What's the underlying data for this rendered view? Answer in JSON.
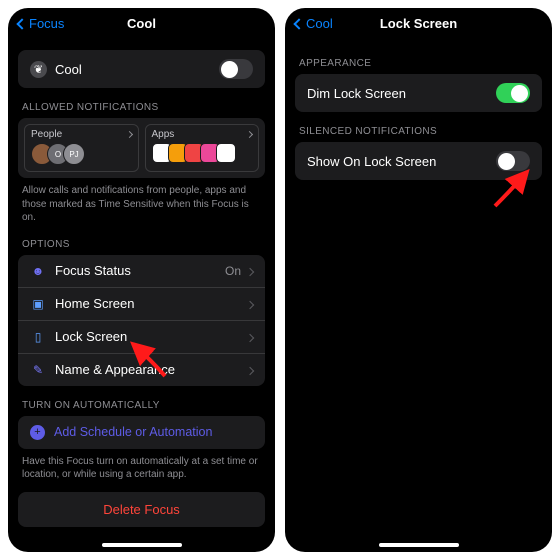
{
  "left": {
    "back_label": "Focus",
    "title": "Cool",
    "focus_name": "Cool",
    "allowed_header": "ALLOWED NOTIFICATIONS",
    "people_label": "People",
    "apps_label": "Apps",
    "allowed_footer": "Allow calls and notifications from people, apps and those marked as Time Sensitive when this Focus is on.",
    "options_header": "OPTIONS",
    "options": {
      "focus_status": "Focus Status",
      "focus_status_value": "On",
      "home_screen": "Home Screen",
      "lock_screen": "Lock Screen",
      "name_appearance": "Name & Appearance"
    },
    "auto_header": "TURN ON AUTOMATICALLY",
    "add_schedule": "Add Schedule or Automation",
    "auto_footer": "Have this Focus turn on automatically at a set time or location, or while using a certain app.",
    "delete": "Delete Focus"
  },
  "right": {
    "back_label": "Cool",
    "title": "Lock Screen",
    "appearance_header": "APPEARANCE",
    "dim_lock": "Dim Lock Screen",
    "silenced_header": "SILENCED NOTIFICATIONS",
    "show_lock": "Show On Lock Screen"
  }
}
